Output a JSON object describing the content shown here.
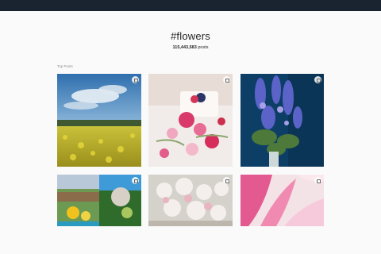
{
  "hashtag": "#flowers",
  "post_count": "115,443,583",
  "post_count_label": "posts",
  "section_label": "Top Posts",
  "colors": {
    "topbar": "#1a2330",
    "background": "#fafafa"
  },
  "posts": [
    {
      "subject": "yellow-rapeseed-field",
      "icon": "multi-photo-icon"
    },
    {
      "subject": "pink-flower-cake",
      "icon": "multi-photo-icon"
    },
    {
      "subject": "blue-larkspur-bouquet",
      "icon": "multi-photo-icon"
    },
    {
      "subject": "garden-collage",
      "icon": "multi-photo-icon"
    },
    {
      "subject": "white-pink-roses",
      "icon": "multi-photo-icon"
    },
    {
      "subject": "pink-petal-closeup",
      "icon": "multi-photo-icon"
    }
  ]
}
